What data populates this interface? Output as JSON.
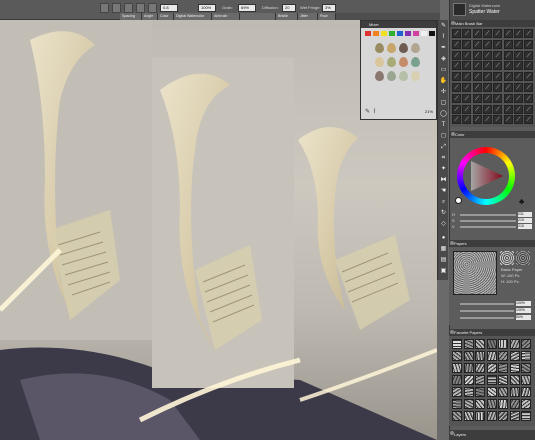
{
  "propbar": {
    "size_value": "0.8",
    "opacity_value": "100%",
    "grain_label": "Grain:",
    "grain_value": "69%",
    "diffusion_label": "Diffusion:",
    "diffusion_value": "20",
    "wet_fringe_label": "Wet Fringe:",
    "wet_fringe_value": "3%"
  },
  "tabs": [
    "Spacing",
    "Angle",
    "Color",
    "Digital Watercolor",
    "Airbrush",
    "",
    "Bristle",
    "Jitter",
    "Flow"
  ],
  "mixer": {
    "title": "Mixer",
    "palette": [
      "#e03030",
      "#f08020",
      "#f0e020",
      "#30b030",
      "#2060d0",
      "#8030b0",
      "#d040a0",
      "#f0f0f0",
      "#111111"
    ],
    "drops": [
      "#9a8c62",
      "#c6a66a",
      "#6e5c52",
      "#b1a692",
      "#d9c69a",
      "#a8aa78",
      "#c48c6a",
      "#7aa090",
      "#8a7870",
      "#9aa692",
      "#b4c0a8",
      "#d8d0b0"
    ],
    "zoom_label": "21%"
  },
  "brush_bar": {
    "category": "Digital Watercolor",
    "variant": "Spatter Water",
    "title": "Main Brush Bar"
  },
  "color_panel": {
    "title": "Color",
    "sliders": [
      "H",
      "S",
      "V"
    ],
    "values": [
      "231",
      "219",
      "215"
    ],
    "accent": "#c80e2a"
  },
  "papers": {
    "title": "Papers",
    "name": "Basic Paper",
    "width": "W: 100 Px.",
    "height": "H: 100 Px.",
    "scale_value": "100%",
    "contrast_value": "100%",
    "brightness_value": "50%"
  },
  "favorite_papers": {
    "title": "Favorite Papers"
  },
  "layers": {
    "title": "Layers"
  },
  "icons": [
    "brush-icon",
    "dropper-icon",
    "pen-icon",
    "text-icon",
    "rect-select-icon",
    "lasso-icon",
    "transform-icon",
    "crop-icon",
    "magic-wand-icon",
    "hand-icon",
    "rotate-icon",
    "zoom-icon",
    "mirror-icon",
    "fill-icon",
    "eraser-icon"
  ]
}
